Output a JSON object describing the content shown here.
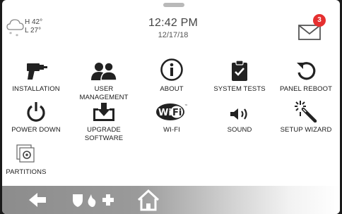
{
  "header": {
    "weather": {
      "high": "H 42°",
      "low": "L 27°",
      "icon": "snow-cloud-icon"
    },
    "time": "12:42 PM",
    "date": "12/17/18",
    "messages": {
      "count": "3",
      "icon": "envelope-icon"
    }
  },
  "tiles": [
    {
      "label": "INSTALLATION",
      "icon": "drill-icon"
    },
    {
      "label": "USER MANAGEMENT",
      "icon": "users-icon"
    },
    {
      "label": "ABOUT",
      "icon": "info-icon"
    },
    {
      "label": "SYSTEM TESTS",
      "icon": "clipboard-check-icon"
    },
    {
      "label": "PANEL REBOOT",
      "icon": "reboot-icon"
    },
    {
      "label": "POWER DOWN",
      "icon": "power-icon"
    },
    {
      "label": "UPGRADE SOFTWARE",
      "icon": "download-tray-icon"
    },
    {
      "label": "WI-FI",
      "icon": "wifi-logo-icon"
    },
    {
      "label": "SOUND",
      "icon": "speaker-icon"
    },
    {
      "label": "SETUP WIZARD",
      "icon": "magic-wand-icon"
    },
    {
      "label": "PARTITIONS",
      "icon": "partitions-icon"
    }
  ],
  "bottom_bar": {
    "back_icon": "back-arrow-icon",
    "emergency_icons": [
      "shield-icon",
      "flame-icon",
      "medical-cross-icon"
    ],
    "home_icon": "home-icon"
  }
}
